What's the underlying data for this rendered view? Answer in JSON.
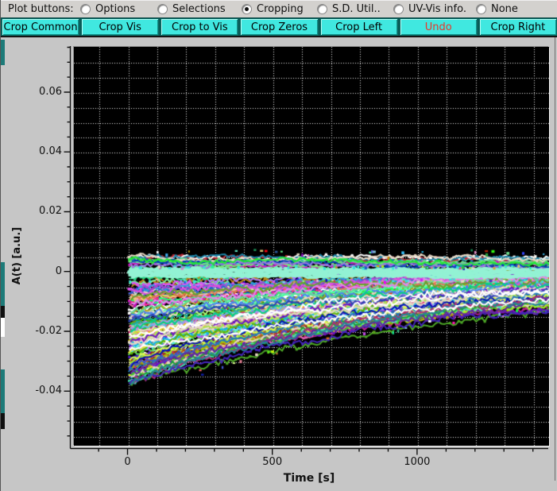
{
  "window": {
    "background": "#c6c6c6"
  },
  "radio_bar": {
    "label": "Plot buttons:",
    "options": [
      {
        "label": "Options",
        "selected": false
      },
      {
        "label": "Selections",
        "selected": false
      },
      {
        "label": "Cropping",
        "selected": true
      },
      {
        "label": "S.D. Util..",
        "selected": false
      },
      {
        "label": "UV-Vis info.",
        "selected": false
      },
      {
        "label": "None",
        "selected": false
      }
    ]
  },
  "button_bar": {
    "face_color": "#40e8e0",
    "buttons": [
      {
        "label": "Crop Common",
        "text_color": "#000000"
      },
      {
        "label": "Crop Vis",
        "text_color": "#000000"
      },
      {
        "label": "Crop to Vis",
        "text_color": "#000000"
      },
      {
        "label": "Crop Zeros",
        "text_color": "#000000"
      },
      {
        "label": "Crop Left",
        "text_color": "#000000"
      },
      {
        "label": "Undo",
        "text_color": "#e8362a"
      },
      {
        "label": "Crop Right",
        "text_color": "#000000"
      }
    ]
  },
  "left_strip": {
    "segments": [
      {
        "y": 3,
        "h": 32,
        "color": "#1d7a78"
      },
      {
        "y": 283,
        "h": 55,
        "color": "#1d7a78"
      },
      {
        "y": 338,
        "h": 15,
        "color": "#101010"
      },
      {
        "y": 353,
        "h": 24,
        "color": "#ffffff"
      },
      {
        "y": 418,
        "h": 55,
        "color": "#1d7a78"
      },
      {
        "y": 473,
        "h": 20,
        "color": "#101010"
      }
    ]
  },
  "chart_data": {
    "type": "line",
    "title": "",
    "xlabel": "Time [s]",
    "ylabel": "A(t) [a.u.]",
    "xlim": [
      -188,
      1453
    ],
    "ylim": [
      -0.058,
      0.0754
    ],
    "x_ticks": {
      "major": [
        {
          "value": 0,
          "label": "0"
        },
        {
          "value": 500,
          "label": "500"
        },
        {
          "value": 1000,
          "label": "1000"
        }
      ],
      "minor_step": 100,
      "minor_range": [
        -100,
        1400
      ]
    },
    "y_ticks": {
      "major": [
        {
          "value": 0.06,
          "label": "0.06"
        },
        {
          "value": 0.04,
          "label": "0.04"
        },
        {
          "value": 0.02,
          "label": "0.02"
        },
        {
          "value": 0,
          "label": "0"
        },
        {
          "value": -0.02,
          "label": "-0.02"
        },
        {
          "value": -0.04,
          "label": "-0.04"
        }
      ],
      "minor_step": 0.005,
      "minor_range": [
        -0.055,
        0.075
      ]
    },
    "grid": {
      "shown": true,
      "style": "dotted",
      "color": "#ebebeb",
      "x_step": 100,
      "y_step": 0.005
    },
    "plot_background": "#000000",
    "ensemble": {
      "description": "Dense bundle of ~155 noisy absorbance kinetic traces starting at t=0, decaying from a spread of initial amplitudes toward zero; solid pale-aquamarine band of baseline traces at A=0",
      "n_traces": 155,
      "t_start": 0,
      "t_end": 1452,
      "initial_value_range": [
        -0.0395,
        0.005
      ],
      "final_value_range": [
        -0.0105,
        0.004
      ],
      "decay_tau_range_s": [
        950,
        1350
      ],
      "noise_amplitude": 0.0018,
      "zero_band": {
        "color": "#93f2d4",
        "value_range": [
          -0.0017,
          0.0013
        ]
      }
    }
  }
}
